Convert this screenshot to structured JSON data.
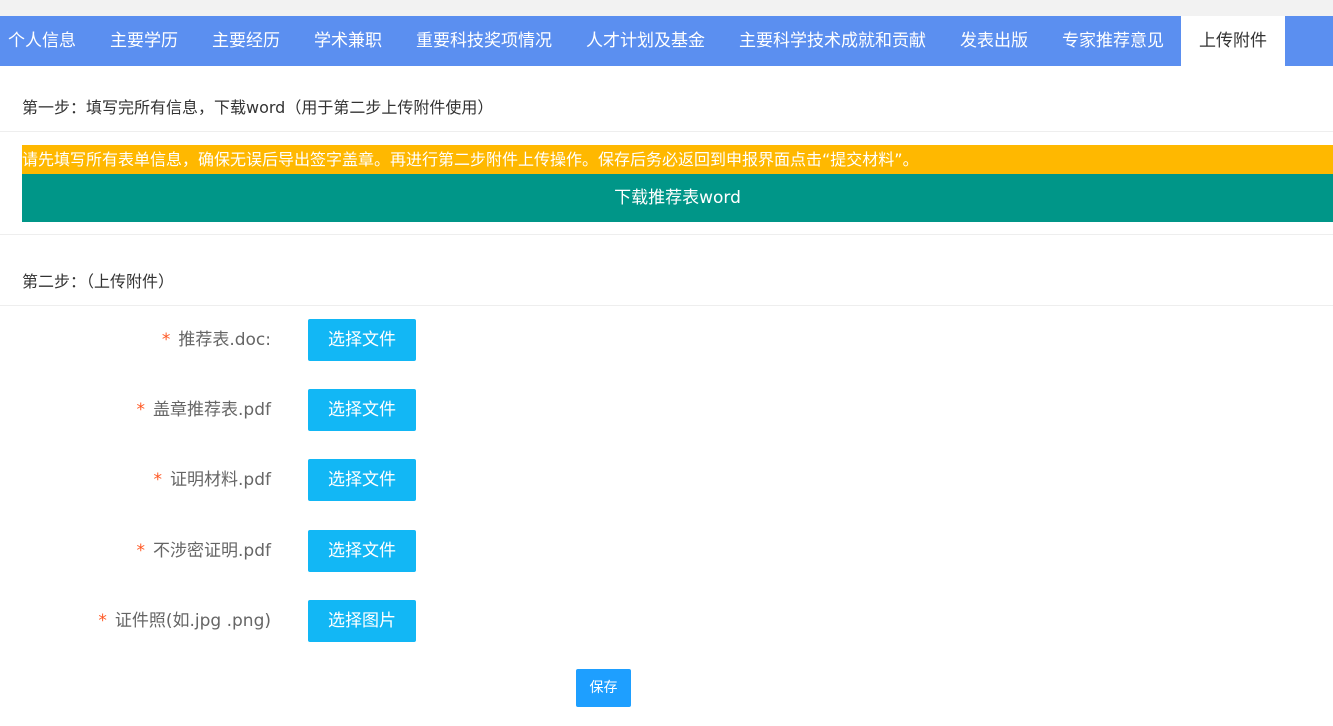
{
  "tabs": [
    {
      "label": "个人信息"
    },
    {
      "label": "主要学历"
    },
    {
      "label": "主要经历"
    },
    {
      "label": "学术兼职"
    },
    {
      "label": "重要科技奖项情况"
    },
    {
      "label": "人才计划及基金"
    },
    {
      "label": "主要科学技术成就和贡献"
    },
    {
      "label": "发表出版"
    },
    {
      "label": "专家推荐意见"
    },
    {
      "label": "上传附件",
      "active": true
    }
  ],
  "step1": {
    "title": "第一步：填写完所有信息，下载word（用于第二步上传附件使用）",
    "notice": "请先填写所有表单信息，确保无误后导出签字盖章。再进行第二步附件上传操作。保存后务必返回到申报界面点击“提交材料”。",
    "download_label": "下载推荐表word"
  },
  "step2": {
    "title": "第二步：（上传附件）",
    "required_mark": "*",
    "fields": [
      {
        "label": "推荐表.doc:",
        "button": "选择文件"
      },
      {
        "label": "盖章推荐表.pdf",
        "button": "选择文件"
      },
      {
        "label": "证明材料.pdf",
        "button": "选择文件"
      },
      {
        "label": "不涉密证明.pdf",
        "button": "选择文件"
      },
      {
        "label": "证件照(如.jpg .png)",
        "button": "选择图片"
      }
    ],
    "save_label": "保存"
  },
  "colors": {
    "tab_bar": "#5b8ff0",
    "notice_bg": "#ffb800",
    "download_bg": "#009688",
    "file_button": "#12b7f5",
    "save_button": "#1e9fff",
    "required": "#ff5722"
  }
}
